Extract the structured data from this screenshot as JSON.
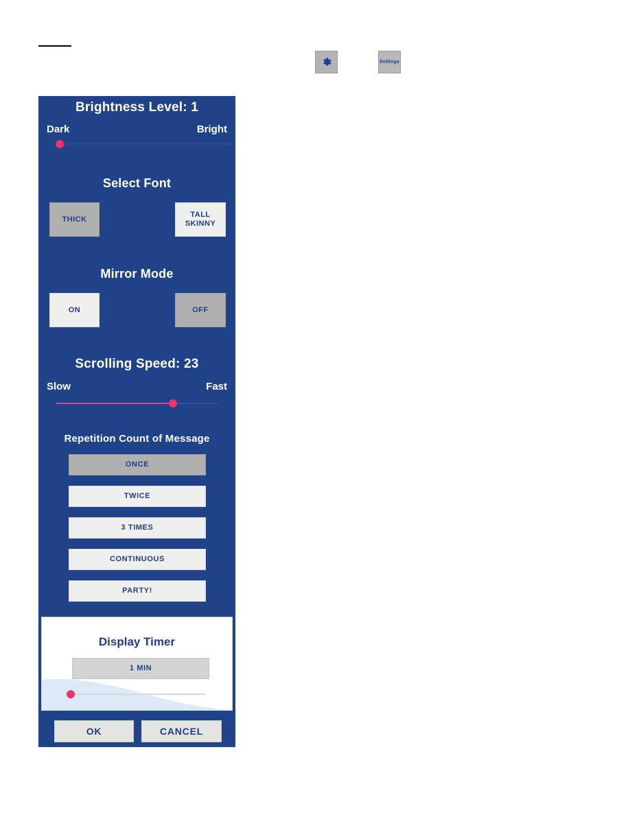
{
  "toolbar": {
    "gear_button": {
      "icon": "gear-icon",
      "label": ""
    },
    "settings_button": {
      "label": "Settings"
    }
  },
  "panel": {
    "background_color": "#1f4289",
    "brightness": {
      "title": "Brightness Level: 1",
      "value": 1,
      "min_label": "Dark",
      "max_label": "Bright",
      "thumb_percent": 2,
      "thumb_color": "#f0316b"
    },
    "select_font": {
      "title": "Select Font",
      "options": [
        {
          "label": "THICK",
          "selected": true
        },
        {
          "label": "TALL\nSKINNY",
          "selected": false
        }
      ]
    },
    "mirror_mode": {
      "title": "Mirror Mode",
      "options": [
        {
          "label": "ON",
          "selected": false
        },
        {
          "label": "OFF",
          "selected": true
        }
      ]
    },
    "scrolling_speed": {
      "title": "Scrolling Speed: 23",
      "value": 23,
      "min_label": "Slow",
      "max_label": "Fast",
      "thumb_percent": 72,
      "fill_color": "#e0449a",
      "thumb_color": "#f0316b"
    },
    "repetition": {
      "title": "Repetition Count of Message",
      "options": [
        {
          "label": "ONCE",
          "selected": true
        },
        {
          "label": "TWICE",
          "selected": false
        },
        {
          "label": "3 TIMES",
          "selected": false
        },
        {
          "label": "CONTINUOUS",
          "selected": false
        },
        {
          "label": "PARTY!",
          "selected": false
        }
      ]
    },
    "display_timer": {
      "title": "Display Timer",
      "value_label": "1 MIN",
      "thumb_percent": 2,
      "thumb_color": "#e8356b"
    },
    "actions": {
      "ok_label": "OK",
      "cancel_label": "CANCEL"
    }
  }
}
